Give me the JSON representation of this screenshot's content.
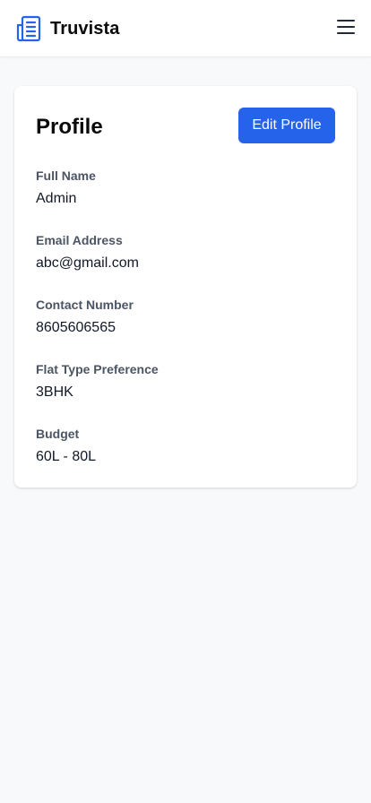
{
  "header": {
    "brand_name": "Truvista",
    "brand_icon": "building-icon",
    "menu_icon": "hamburger-menu-icon",
    "accent_color": "#2563eb"
  },
  "profile": {
    "title": "Profile",
    "edit_button_label": "Edit Profile",
    "fields": [
      {
        "label": "Full Name",
        "value": "Admin"
      },
      {
        "label": "Email Address",
        "value": "abc@gmail.com"
      },
      {
        "label": "Contact Number",
        "value": "8605606565"
      },
      {
        "label": "Flat Type Preference",
        "value": "3BHK"
      },
      {
        "label": "Budget",
        "value": "60L - 80L"
      }
    ]
  }
}
